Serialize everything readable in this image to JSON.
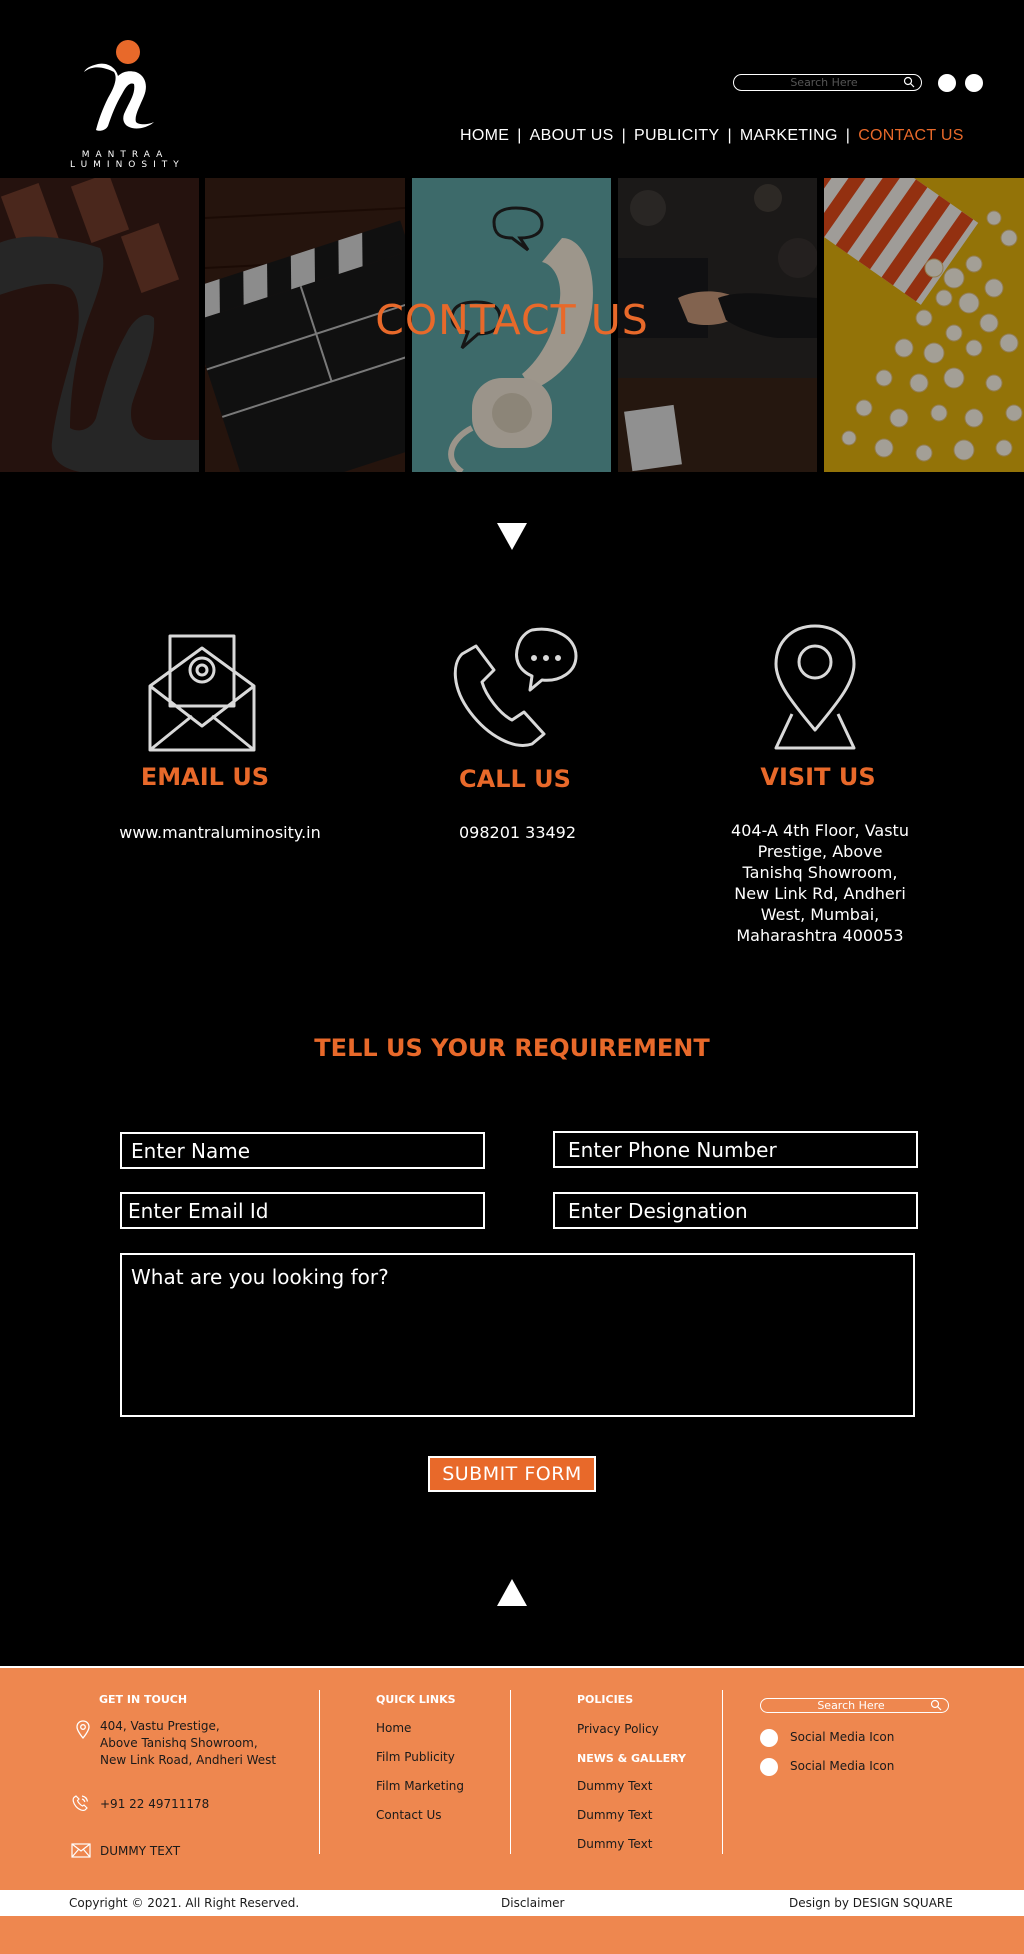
{
  "brand": {
    "logo_line1": "MANTRAA",
    "logo_line2": "LUMINOSITY"
  },
  "header": {
    "search_placeholder": "Search Here"
  },
  "nav": {
    "items": [
      {
        "label": "HOME"
      },
      {
        "label": "ABOUT US"
      },
      {
        "label": "PUBLICITY"
      },
      {
        "label": "MARKETING"
      },
      {
        "label": "CONTACT US"
      }
    ],
    "separator": "|",
    "active": "CONTACT US"
  },
  "hero": {
    "title": "CONTACT US"
  },
  "contact_cards": {
    "email": {
      "title": "EMAIL US",
      "text": "www.mantraluminosity.in",
      "icon": "envelope-icon"
    },
    "call": {
      "title": "CALL US",
      "text": "098201 33492",
      "icon": "phone-icon"
    },
    "visit": {
      "title": "VISIT US",
      "lines": [
        "404-A 4th Floor, Vastu",
        "Prestige, Above",
        "Tanishq Showroom,",
        "New Link Rd, Andheri",
        "West, Mumbai,",
        "Maharashtra 400053"
      ],
      "icon": "location-pin-icon"
    }
  },
  "form": {
    "title": "TELL US YOUR REQUIREMENT",
    "name_placeholder": "Enter Name",
    "phone_placeholder": "Enter Phone Number",
    "email_placeholder": "Enter Email Id",
    "designation_placeholder": "Enter Designation",
    "message_placeholder": "What are you looking for?",
    "submit_label": "SUBMIT FORM"
  },
  "footer": {
    "get_in_touch": {
      "heading": "GET IN TOUCH",
      "address_lines": [
        "404, Vastu Prestige,",
        "Above Tanishq Showroom,",
        "New Link Road, Andheri West"
      ],
      "phone": "+91 22 49711178",
      "email": "DUMMY TEXT"
    },
    "quick_links": {
      "heading": "QUICK LINKS",
      "items": [
        "Home",
        "Film Publicity",
        "Film Marketing",
        "Contact Us"
      ]
    },
    "policies": {
      "heading": "POLICIES",
      "items": [
        "Privacy Policy"
      ]
    },
    "news": {
      "heading": "NEWS & GALLERY",
      "items": [
        "Dummy Text",
        "Dummy Text",
        "Dummy Text"
      ]
    },
    "search_placeholder": "Search Here",
    "social": [
      "Social Media Icon",
      "Social Media Icon"
    ]
  },
  "bottom_bar": {
    "copyright": "Copyright © 2021. All Right Reserved.",
    "disclaimer": "Disclaimer",
    "credit": "Design by DESIGN SQUARE"
  },
  "colors": {
    "accent": "#e8692a",
    "footer_bg": "#ee874f",
    "background": "#000000"
  }
}
